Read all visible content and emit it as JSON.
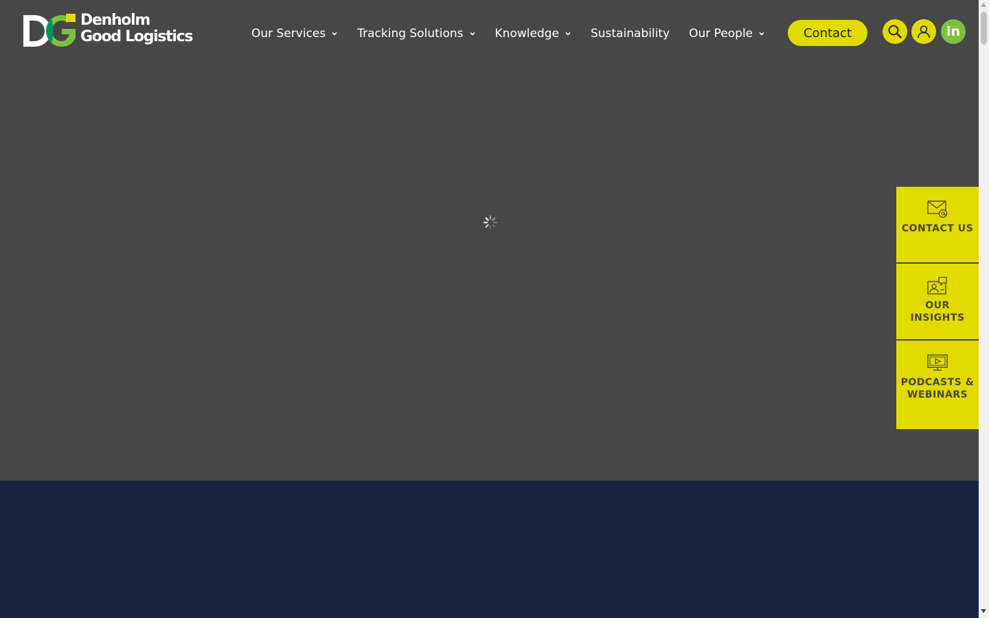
{
  "brand": {
    "name_line1": "Denholm",
    "name_line2": "Good Logistics",
    "mark": "DG",
    "colors": {
      "yellow": "#e1db00",
      "green": "#7cc242",
      "dark_green": "#00965e",
      "grey": "#474747",
      "navy": "#192240"
    }
  },
  "nav": {
    "items": [
      {
        "label": "Our Services",
        "has_dropdown": true
      },
      {
        "label": "Tracking Solutions",
        "has_dropdown": true
      },
      {
        "label": "Knowledge",
        "has_dropdown": true
      },
      {
        "label": "Sustainability",
        "has_dropdown": false
      },
      {
        "label": "Our People",
        "has_dropdown": true
      }
    ],
    "contact_label": "Contact"
  },
  "header_icons": {
    "search": "search-icon",
    "account": "user-icon",
    "linkedin": "linkedin-icon",
    "linkedin_text": "in"
  },
  "hero": {
    "loading_indicator": "spinner-icon"
  },
  "side_panel": {
    "tabs": [
      {
        "label": "CONTACT US",
        "icon": "mail-at-icon"
      },
      {
        "label": "OUR INSIGHTS",
        "icon": "person-speech-icon"
      },
      {
        "label": "PODCASTS & WEBINARS",
        "icon": "monitor-play-icon"
      }
    ]
  }
}
